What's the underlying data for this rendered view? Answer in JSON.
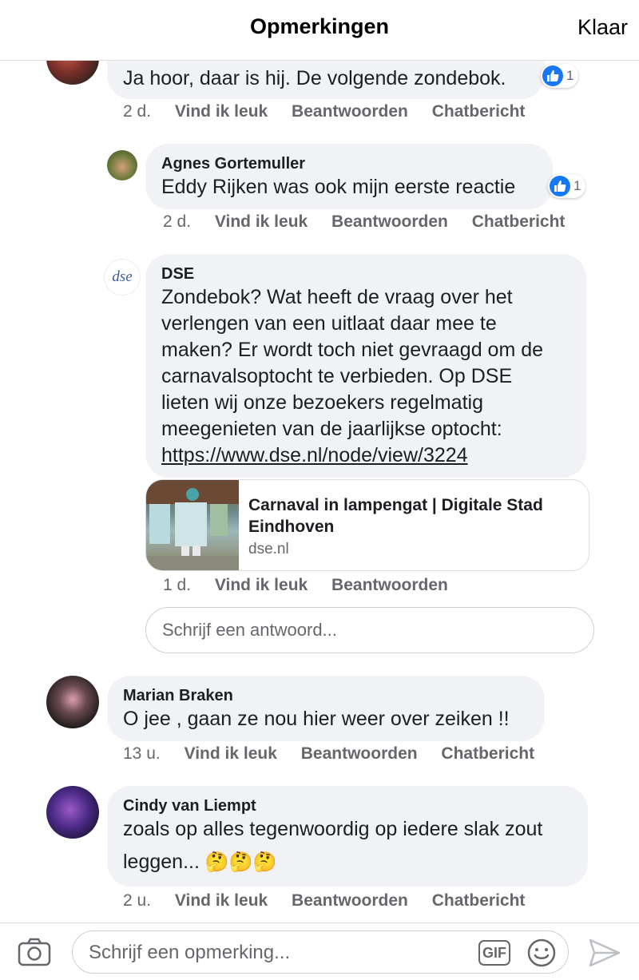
{
  "header": {
    "title": "Opmerkingen",
    "done": "Klaar"
  },
  "comments": [
    {
      "text": "Ja hoor, daar is hij. De volgende zondebok.",
      "reaction_count": "1",
      "time": "2 d.",
      "like": "Vind ik leuk",
      "reply": "Beantwoorden",
      "message": "Chatbericht"
    },
    {
      "author": "Agnes Gortemuller",
      "text": "Eddy Rijken was ook mijn eerste reactie",
      "reaction_count": "1",
      "time": "2 d.",
      "like": "Vind ik leuk",
      "reply": "Beantwoorden",
      "message": "Chatbericht"
    },
    {
      "author": "DSE",
      "avatar_text": "dse",
      "text_lines": [
        "Zondebok? Wat heeft de vraag over het",
        "verlengen van een uitlaat daar mee te",
        "maken? Er wordt toch niet gevraagd om de",
        "carnavalsoptocht te verbieden. Op DSE",
        "lieten wij onze bezoekers regelmatig",
        "meegenieten van de jaarlijkse optocht:"
      ],
      "link": "https://www.dse.nl/node/view/3224",
      "preview": {
        "title": "Carnaval in lampengat | Digitale Stad Eindhoven",
        "domain": "dse.nl"
      },
      "time": "1 d.",
      "like": "Vind ik leuk",
      "reply": "Beantwoorden"
    },
    {
      "author": "Marian Braken",
      "text": "O jee , gaan ze nou hier weer over zeiken !!",
      "time": "13 u.",
      "like": "Vind ik leuk",
      "reply": "Beantwoorden",
      "message": "Chatbericht"
    },
    {
      "author": "Cindy van Liempt",
      "text_line1": "zoals op alles tegenwoordig op iedere slak zout",
      "text_line2": "leggen...",
      "emoji": "🤔🤔🤔",
      "time": "2 u.",
      "like": "Vind ik leuk",
      "reply": "Beantwoorden",
      "message": "Chatbericht"
    }
  ],
  "reply_input": {
    "placeholder": "Schrijf een antwoord..."
  },
  "composer": {
    "placeholder": "Schrijf een opmerking...",
    "gif": "GIF"
  },
  "colors": {
    "like_blue": "#1877f2",
    "bubble": "#f0f2f5",
    "meta": "#65676b"
  }
}
